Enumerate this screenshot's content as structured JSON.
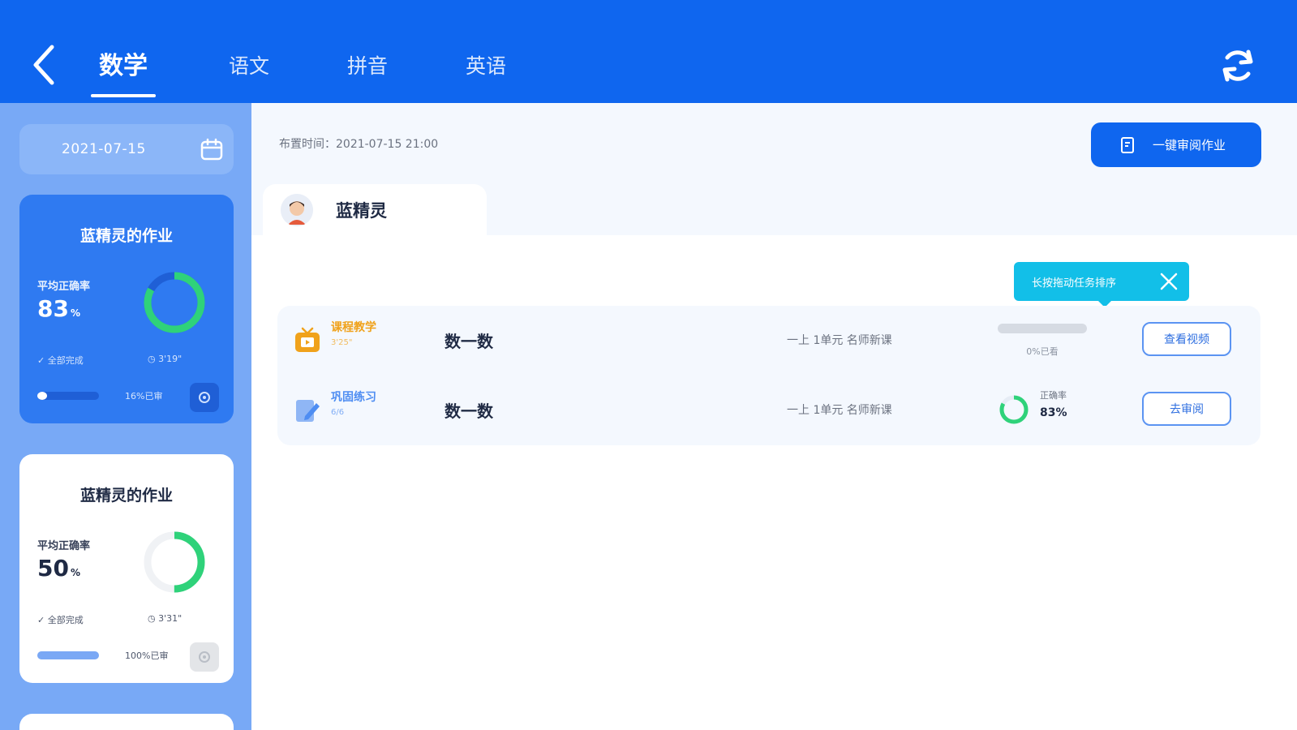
{
  "header": {
    "tabs": [
      {
        "label": "数学",
        "active": true
      },
      {
        "label": "语文",
        "active": false
      },
      {
        "label": "拼音",
        "active": false
      },
      {
        "label": "英语",
        "active": false
      }
    ],
    "back_icon": "chevron-left-icon",
    "refresh_icon": "refresh-icon",
    "bg_color": "#0f66ef"
  },
  "sidebar": {
    "date": "2021-07-15",
    "date_icon": "calendar-icon",
    "cards": [
      {
        "title": "蓝精灵的作业",
        "accuracy_label": "平均正确率",
        "accuracy_value": "83",
        "accuracy_unit": "%",
        "accuracy_fraction": 0.83,
        "done_label": "全部完成",
        "time_label": "3'19\"",
        "progress_fraction": 0.16,
        "progress_text": "16%已审",
        "badge_icon": "gear-icon",
        "active": true
      },
      {
        "title": "蓝精灵的作业",
        "accuracy_label": "平均正确率",
        "accuracy_value": "50",
        "accuracy_unit": "%",
        "accuracy_fraction": 0.5,
        "done_label": "全部完成",
        "time_label": "3'31\"",
        "progress_fraction": 1.0,
        "progress_text": "100%已审",
        "badge_icon": "gear-icon",
        "active": false
      }
    ]
  },
  "main": {
    "assign_time": "布置时间：2021-07-15 21:00",
    "review_all_label": "一键审阅作业",
    "review_all_icon": "document-icon",
    "student_name": "蓝精灵",
    "tooltip_text": "长按拖动任务排序",
    "tooltip_close_icon": "close-icon",
    "tasks": [
      {
        "type": "课程教学",
        "type_color": "#f0a21b",
        "sub": "3'25\"",
        "name": "数一数",
        "unit": "一上 1单元 名师新课",
        "progress_fraction": 0.0,
        "progress_text": "0%已看",
        "button_label": "查看视频",
        "icon": "video-icon"
      },
      {
        "type": "巩固练习",
        "type_color": "#4e8df2",
        "sub": "6/6",
        "name": "数一数",
        "unit": "一上 1单元 名师新课",
        "accuracy_label": "正确率",
        "accuracy_value": "83%",
        "accuracy_fraction": 0.83,
        "button_label": "去审阅",
        "icon": "exercise-icon"
      }
    ]
  },
  "colors": {
    "accent": "#0f66ef",
    "success": "#2fd27a",
    "sidebar_bg": "#78a9f6",
    "tooltip": "#12bfe8"
  }
}
